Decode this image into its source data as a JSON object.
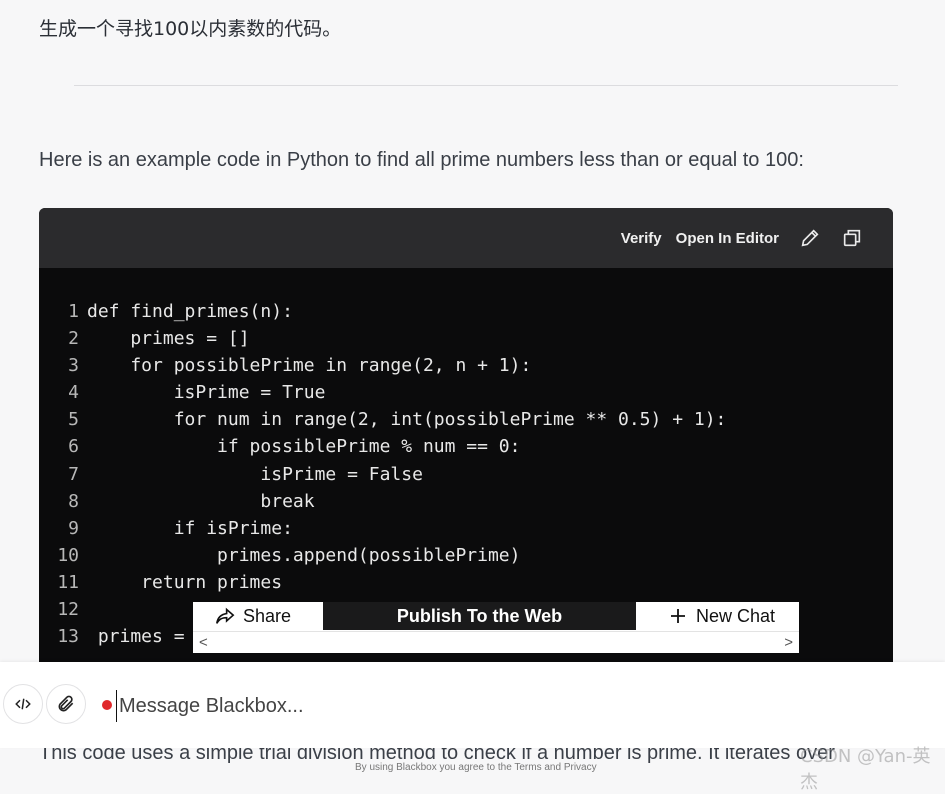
{
  "user_message": "生成一个寻找100以内素数的代码。",
  "intro": "Here is an example code in Python to find all prime numbers less than or equal to 100:",
  "code_header": {
    "verify_label": "Verify",
    "open_editor_label": "Open In Editor",
    "edit_icon": "pencil-icon",
    "copy_icon": "copy-icon"
  },
  "code_lines": [
    {
      "n": "1",
      "t": "def find_primes(n):"
    },
    {
      "n": "2",
      "t": "    primes = []"
    },
    {
      "n": "3",
      "t": "    for possiblePrime in range(2, n + 1):"
    },
    {
      "n": "4",
      "t": "        isPrime = True"
    },
    {
      "n": "5",
      "t": "        for num in range(2, int(possiblePrime ** 0.5) + 1):"
    },
    {
      "n": "6",
      "t": "            if possiblePrime % num == 0:"
    },
    {
      "n": "7",
      "t": "                isPrime = False"
    },
    {
      "n": "8",
      "t": "                break"
    },
    {
      "n": "9",
      "t": "        if isPrime:"
    },
    {
      "n": "10",
      "t": "            primes.append(possiblePrime)"
    },
    {
      "n": "11",
      "t": "     return primes"
    },
    {
      "n": "12",
      "t": ""
    },
    {
      "n": "13",
      "t": " primes = "
    }
  ],
  "float_bar": {
    "share_label": "Share",
    "publish_label": "Publish To the Web",
    "new_chat_label": "New Chat",
    "scroll_left": "<",
    "scroll_right": ">"
  },
  "input": {
    "placeholder": "Message Blackbox..."
  },
  "bottom_text": "This code uses a simple trial division method to check if a number is prime. It iterates over",
  "terms_text": "By using Blackbox you agree to the Terms and Privacy",
  "watermark": "CSDN @Yan-英杰",
  "colors": {
    "page_bg": "#f7f7f8",
    "code_bg": "#0b0b0c",
    "header_bg": "#2b2b2d",
    "recording_dot": "#e0282b"
  }
}
